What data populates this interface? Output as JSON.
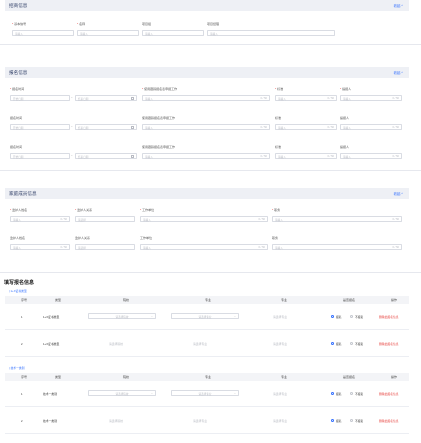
{
  "basic": {
    "title": "招商信息",
    "toggle": "收起 ^",
    "fields": [
      {
        "label": "基本信号",
        "required": true,
        "placeholder": "请输入"
      },
      {
        "label": "名称",
        "required": true,
        "placeholder": "请输入"
      },
      {
        "label": "项目组",
        "required": false,
        "placeholder": "请输入"
      },
      {
        "label": "项目经理",
        "required": false,
        "placeholder": "请输入"
      }
    ]
  },
  "report": {
    "title": "报名信息",
    "toggle": "收起 ^",
    "rows": [
      {
        "date_label": "报名时间",
        "date_required": true,
        "start_ph": "开始日期",
        "end_ph": "结束日期",
        "c2_label": "使用跟踪报名表申报工作",
        "c2_required": true,
        "c2_ph": "请输入",
        "c2_count": "0 / 50",
        "c3_label": "标准",
        "c3_required": true,
        "c3_ph": "请输入",
        "c3_count": "0 / 50",
        "c4_label": "提报人",
        "c4_required": true,
        "c4_ph": "请输入",
        "c4_count": "0 / 50"
      },
      {
        "date_label": "报名时间",
        "date_required": false,
        "start_ph": "开始日期",
        "end_ph": "结束日期",
        "c2_label": "使用跟踪报名表申报工作",
        "c2_required": false,
        "c2_ph": "请输入",
        "c2_count": "0 / 50",
        "c3_label": "标准",
        "c3_required": false,
        "c3_ph": "请输入",
        "c3_count": "0 / 50",
        "c4_label": "提报人",
        "c4_required": false,
        "c4_ph": "请输入",
        "c4_count": "0 / 50"
      },
      {
        "date_label": "报名时间",
        "date_required": false,
        "start_ph": "开始日期",
        "end_ph": "结束日期",
        "c2_label": "使用跟踪报名表申报工作",
        "c2_required": false,
        "c2_ph": "请输入",
        "c2_count": "0 / 50",
        "c3_label": "标准",
        "c3_required": false,
        "c3_ph": "请输入",
        "c3_count": "0 / 50",
        "c4_label": "提报人",
        "c4_required": false,
        "c4_ph": "请输入",
        "c4_count": "0 / 50"
      }
    ]
  },
  "family": {
    "title": "家庭成员信息",
    "toggle": "收起 ^",
    "rows": [
      {
        "c1_label": "监护人姓名",
        "c2_label": "监护人关系",
        "c3_label": "工作单位",
        "c4_label": "职务",
        "required": true,
        "c1_ph": "请输入",
        "c1_count": "0 / 50",
        "c2_ph": "请选择",
        "c3_ph": "请输入",
        "c3_count": "0 / 50",
        "c4_ph": "请输入",
        "c4_count": "0 / 50"
      },
      {
        "c1_label": "监护人姓名",
        "c2_label": "监护人关系",
        "c3_label": "工作单位",
        "c4_label": "职务",
        "required": false,
        "c1_ph": "请输入",
        "c1_count": "0 / 50",
        "c2_ph": "请选择",
        "c3_ph": "请输入",
        "c3_count": "0 / 50",
        "c4_ph": "请输入",
        "c4_count": "0 / 50"
      }
    ]
  },
  "signup": {
    "title": "填写报名信息",
    "groups": [
      {
        "name": "| 1+X证书类型",
        "headers": [
          "序号",
          "类型",
          "院校",
          "专业",
          "专业",
          "是否报名",
          "操作"
        ],
        "rows": [
          {
            "no": "1",
            "type": "1+X证书类型",
            "school_ph": "请选择院校",
            "major_ph": "请选择专业",
            "major2_ph": "请选择专业",
            "yes": "报名",
            "no_label": "不报名",
            "action": "删除此报名信息"
          },
          {
            "no": "2",
            "type": "1+X证书类型",
            "school_ph": "请选择院校",
            "major_ph": "请选择专业",
            "major2_ph": "请选择专业",
            "yes": "报名",
            "no_label": "不报名",
            "action": "删除此报名信息"
          }
        ]
      },
      {
        "name": "| 技术一类别",
        "headers": [
          "序号",
          "类型",
          "院校",
          "专业",
          "专业",
          "是否报名",
          "操作"
        ],
        "rows": [
          {
            "no": "1",
            "type": "技术一类别",
            "school_ph": "请选择院校",
            "major_ph": "请选择专业",
            "major2_ph": "请选择专业",
            "yes": "报名",
            "no_label": "不报名",
            "action": "删除此报名信息"
          },
          {
            "no": "2",
            "type": "技术一类别",
            "school_ph": "请选择院校",
            "major_ph": "请选择专业",
            "major2_ph": "请选择专业",
            "yes": "报名",
            "no_label": "不报名",
            "action": "删除此报名信息"
          }
        ]
      }
    ]
  },
  "colors": {
    "accent": "#3370ff",
    "danger": "#e53935",
    "section_bg": "#eef0f5"
  },
  "icons": [
    "calendar-icon",
    "chevron-down-icon",
    "radio-icon"
  ]
}
